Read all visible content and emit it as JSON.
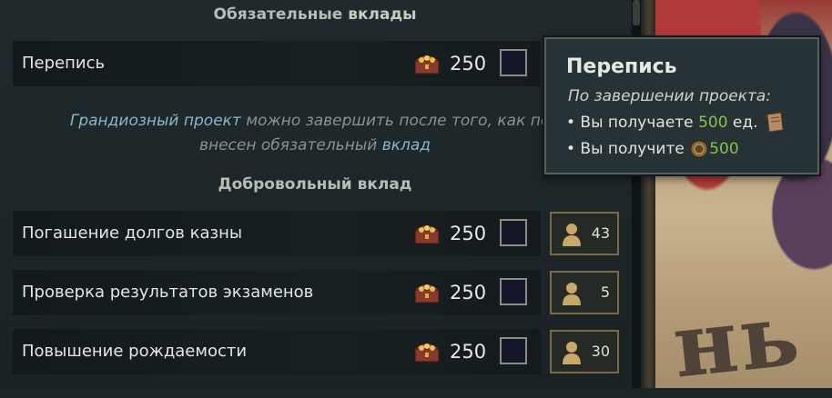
{
  "sections": {
    "mandatory": {
      "part1": "Обязательные",
      "part2": "вклады"
    },
    "voluntary": {
      "title": "Добровольный вклад"
    }
  },
  "mandatory_rows": [
    {
      "label": "Перепись",
      "cost": "250",
      "icon": "treasure-chest-icon"
    }
  ],
  "info": {
    "link1": "Грандиозный проект",
    "text1": " можно завершить после того, как пол",
    "text2": "внесен обязательный ",
    "link2": "вклад"
  },
  "voluntary_rows": [
    {
      "label": "Погашение долгов казны",
      "cost": "250",
      "pops": "43"
    },
    {
      "label": "Проверка результатов экзаменов",
      "cost": "250",
      "pops": "5"
    },
    {
      "label": "Повышение рождаемости",
      "cost": "250",
      "pops": "30"
    }
  ],
  "tooltip": {
    "title": "Перепись",
    "subtitle": "По завершении проекта:",
    "line1_prefix": "• Вы получаете ",
    "line1_value": "500",
    "line1_suffix": " ед.",
    "line1_icon": "scroll-icon",
    "line2_prefix": "• Вы получите",
    "line2_value": "500",
    "line2_icon": "coin-icon"
  },
  "map": {
    "letters": "нь"
  },
  "colors": {
    "highlight_green": "#87c24a",
    "link_blue": "#8fb6c8",
    "panel": "#1d2528"
  }
}
